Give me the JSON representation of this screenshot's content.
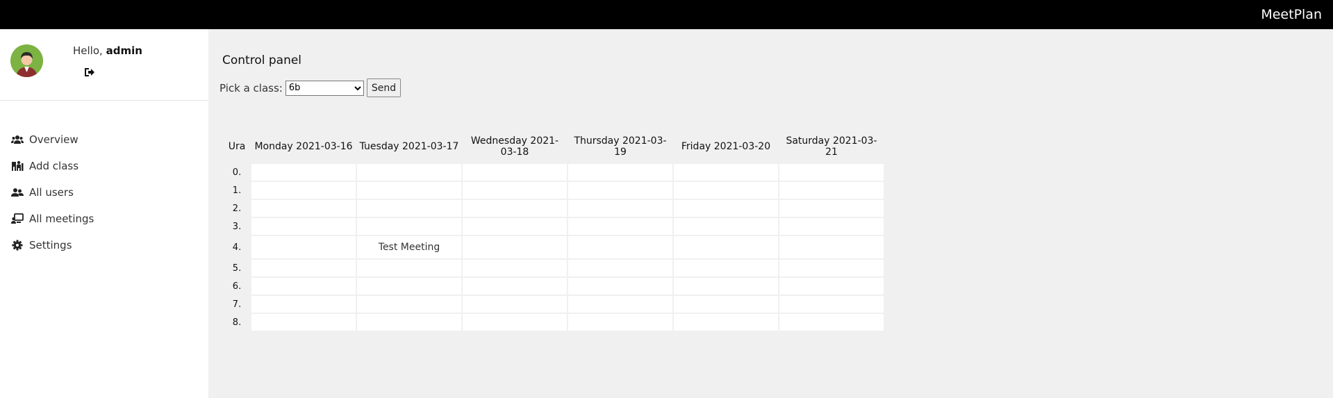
{
  "app": {
    "brand": "MeetPlan"
  },
  "user": {
    "greeting_prefix": "Hello,",
    "username": "admin"
  },
  "sidebar": {
    "items": [
      {
        "label": "Overview",
        "icon": "users-icon"
      },
      {
        "label": "Add class",
        "icon": "class-icon"
      },
      {
        "label": "All users",
        "icon": "user-group-icon"
      },
      {
        "label": "All meetings",
        "icon": "meeting-icon"
      },
      {
        "label": "Settings",
        "icon": "gear-icon"
      }
    ]
  },
  "main": {
    "title": "Control panel",
    "picker": {
      "label": "Pick a class:",
      "selected": "6b",
      "send_label": "Send"
    }
  },
  "schedule": {
    "corner": "Ura",
    "days": [
      "Monday 2021-03-16",
      "Tuesday 2021-03-17",
      "Wednesday 2021-03-18",
      "Thursday 2021-03-19",
      "Friday 2021-03-20",
      "Saturday 2021-03-21"
    ],
    "rows": [
      {
        "hour": "0.",
        "cells": [
          "",
          "",
          "",
          "",
          "",
          ""
        ]
      },
      {
        "hour": "1.",
        "cells": [
          "",
          "",
          "",
          "",
          "",
          ""
        ]
      },
      {
        "hour": "2.",
        "cells": [
          "",
          "",
          "",
          "",
          "",
          ""
        ]
      },
      {
        "hour": "3.",
        "cells": [
          "",
          "",
          "",
          "",
          "",
          ""
        ]
      },
      {
        "hour": "4.",
        "cells": [
          "",
          "Test Meeting",
          "",
          "",
          "",
          ""
        ]
      },
      {
        "hour": "5.",
        "cells": [
          "",
          "",
          "",
          "",
          "",
          ""
        ]
      },
      {
        "hour": "6.",
        "cells": [
          "",
          "",
          "",
          "",
          "",
          ""
        ]
      },
      {
        "hour": "7.",
        "cells": [
          "",
          "",
          "",
          "",
          "",
          ""
        ]
      },
      {
        "hour": "8.",
        "cells": [
          "",
          "",
          "",
          "",
          "",
          ""
        ]
      }
    ]
  }
}
